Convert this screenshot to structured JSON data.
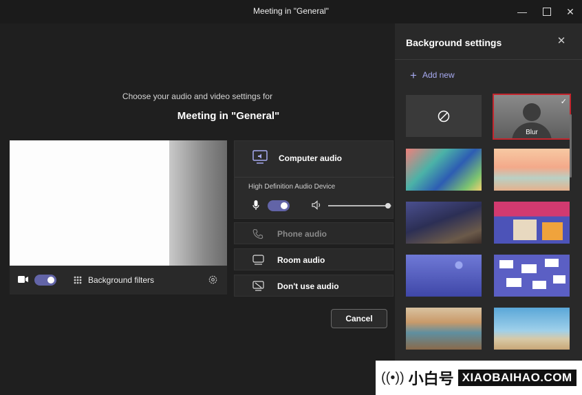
{
  "window": {
    "title": "Meeting in \"General\"",
    "minimize_icon": "minimize-icon",
    "maximize_icon": "maximize-icon",
    "close_icon": "close-icon"
  },
  "prejoin": {
    "subtitle": "Choose your audio and video settings for",
    "meeting_title": "Meeting in \"General\"",
    "camera_toggle": "on",
    "background_filters_label": "Background filters",
    "audio_options": {
      "computer_audio": "Computer audio",
      "device": "High Definition Audio Device",
      "phone_audio": "Phone audio",
      "room_audio": "Room audio",
      "dont_use_audio": "Don't use audio"
    },
    "mic_toggle": "on",
    "speaker_volume": 0.95,
    "cancel_label": "Cancel"
  },
  "background_settings": {
    "title": "Background settings",
    "add_new_label": "Add new",
    "thumbnails": [
      {
        "name": "none",
        "label": ""
      },
      {
        "name": "blur",
        "label": "Blur",
        "selected": true
      },
      {
        "name": "colorful-waves",
        "label": ""
      },
      {
        "name": "pastel-landscape",
        "label": ""
      },
      {
        "name": "living-room",
        "label": ""
      },
      {
        "name": "bookshelf",
        "label": ""
      },
      {
        "name": "purple-planet",
        "label": ""
      },
      {
        "name": "sticky-notes-wall",
        "label": ""
      },
      {
        "name": "office-interior",
        "label": ""
      },
      {
        "name": "beach-horizon",
        "label": ""
      }
    ]
  },
  "watermark": {
    "cn": "小白号",
    "en": "XIAOBAIHAO.COM"
  },
  "colors": {
    "accent": "#6264a7",
    "selected_border": "#c4262e",
    "panel_bg": "#292929",
    "main_bg": "#1f1f1f"
  }
}
